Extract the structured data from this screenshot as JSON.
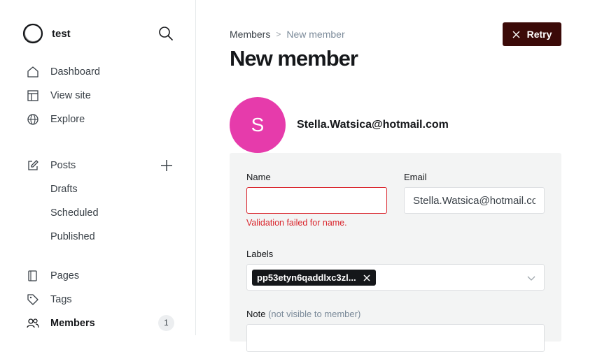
{
  "sidebar": {
    "site_name": "test",
    "items": [
      {
        "label": "Dashboard",
        "icon": "home-icon"
      },
      {
        "label": "View site",
        "icon": "layout-icon"
      },
      {
        "label": "Explore",
        "icon": "globe-icon"
      },
      {
        "label": "Posts",
        "icon": "edit-icon"
      },
      {
        "label": "Drafts"
      },
      {
        "label": "Scheduled"
      },
      {
        "label": "Published"
      },
      {
        "label": "Pages",
        "icon": "page-icon"
      },
      {
        "label": "Tags",
        "icon": "tag-icon"
      },
      {
        "label": "Members",
        "icon": "members-icon",
        "badge": "1"
      }
    ]
  },
  "header": {
    "breadcrumb": {
      "parent": "Members",
      "separator": ">",
      "current": "New member"
    },
    "title": "New member",
    "retry_label": "Retry"
  },
  "member": {
    "avatar_initial": "S",
    "avatar_color": "#e63bab",
    "email_display": "Stella.Watsica@hotmail.com"
  },
  "form": {
    "name_label": "Name",
    "name_value": "",
    "name_error": "Validation failed for name.",
    "email_label": "Email",
    "email_value": "Stella.Watsica@hotmail.com",
    "labels_label": "Labels",
    "label_chip": "pp53etyn6qaddlxc3zl...",
    "note_label": "Note",
    "note_hint": "(not visible to member)"
  },
  "colors": {
    "accent": "#3b0a08",
    "error": "#d9242b"
  }
}
